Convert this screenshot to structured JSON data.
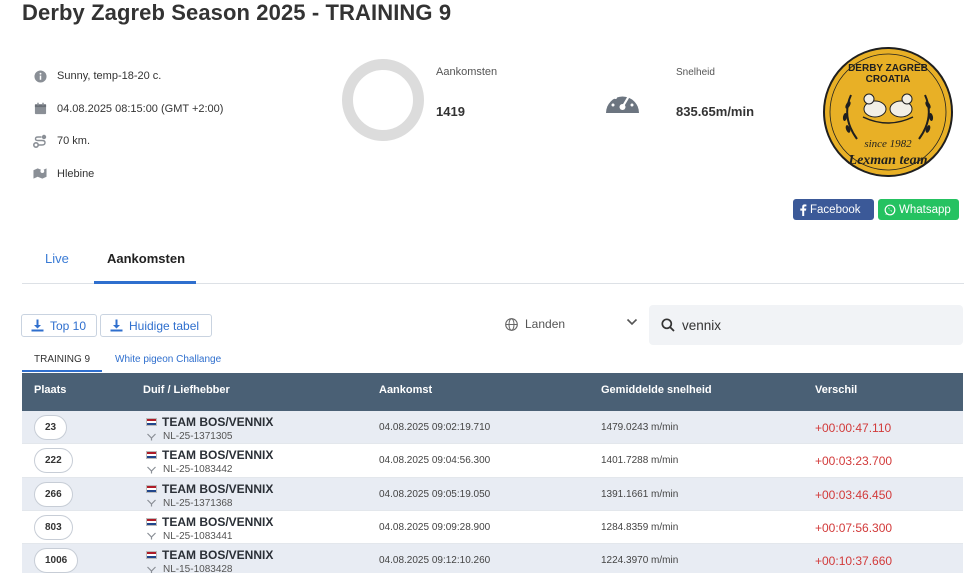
{
  "page": {
    "title": "Derby Zagreb Season 2025 - TRAINING 9"
  },
  "info": {
    "weather": "Sunny, temp-18-20 c.",
    "datetime": "04.08.2025 08:15:00 (GMT +2:00)",
    "distance": "70 km.",
    "location": "Hlebine"
  },
  "stats": {
    "arrivals_label": "Aankomsten",
    "arrivals_value": "1419",
    "speed_label": "Snelheid",
    "speed_value": "835.65m/min"
  },
  "logo": {
    "line1": "DERBY ZAGREB",
    "line2": "CROATIA",
    "since": "since 1982",
    "team": "Lexman team"
  },
  "share": {
    "facebook": "Facebook",
    "whatsapp": "Whatsapp"
  },
  "tabs": {
    "live": "Live",
    "aankomsten": "Aankomsten"
  },
  "toolbar": {
    "top10": "Top 10",
    "current_table": "Huidige tabel",
    "countries": "Landen",
    "search_value": "vennix"
  },
  "subtabs": {
    "training": "TRAINING 9",
    "challenge": "White pigeon Challange"
  },
  "table": {
    "headers": {
      "place": "Plaats",
      "pigeon": "Duif / Liefhebber",
      "arrival": "Aankomst",
      "speed": "Gemiddelde snelheid",
      "diff": "Verschil"
    },
    "rows": [
      {
        "place": "23",
        "team": "TEAM BOS/VENNIX",
        "ring": "NL-25-1371305",
        "arrival": "04.08.2025 09:02:19.710",
        "speed": "1479.0243 m/min",
        "diff": "+00:00:47.110"
      },
      {
        "place": "222",
        "team": "TEAM BOS/VENNIX",
        "ring": "NL-25-1083442",
        "arrival": "04.08.2025 09:04:56.300",
        "speed": "1401.7288 m/min",
        "diff": "+00:03:23.700"
      },
      {
        "place": "266",
        "team": "TEAM BOS/VENNIX",
        "ring": "NL-25-1371368",
        "arrival": "04.08.2025 09:05:19.050",
        "speed": "1391.1661 m/min",
        "diff": "+00:03:46.450"
      },
      {
        "place": "803",
        "team": "TEAM BOS/VENNIX",
        "ring": "NL-25-1083441",
        "arrival": "04.08.2025 09:09:28.900",
        "speed": "1284.8359 m/min",
        "diff": "+00:07:56.300"
      },
      {
        "place": "1006",
        "team": "TEAM BOS/VENNIX",
        "ring": "NL-15-1083428",
        "arrival": "04.08.2025 09:12:10.260",
        "speed": "1224.3970 m/min",
        "diff": "+00:10:37.660"
      }
    ]
  },
  "colors": {
    "accent": "#2f6fce",
    "header_bg": "#4a6075",
    "diff_red": "#d23a3a",
    "facebook": "#3b5998",
    "whatsapp": "#25c261",
    "logo_gold": "#e8b026"
  },
  "icons": [
    "info-icon",
    "calendar-icon",
    "route-icon",
    "map-icon",
    "gauge-icon",
    "facebook-icon",
    "whatsapp-icon",
    "download-icon",
    "globe-icon",
    "chevron-down-icon",
    "search-icon",
    "pigeon-icon",
    "flag-nl-icon"
  ]
}
